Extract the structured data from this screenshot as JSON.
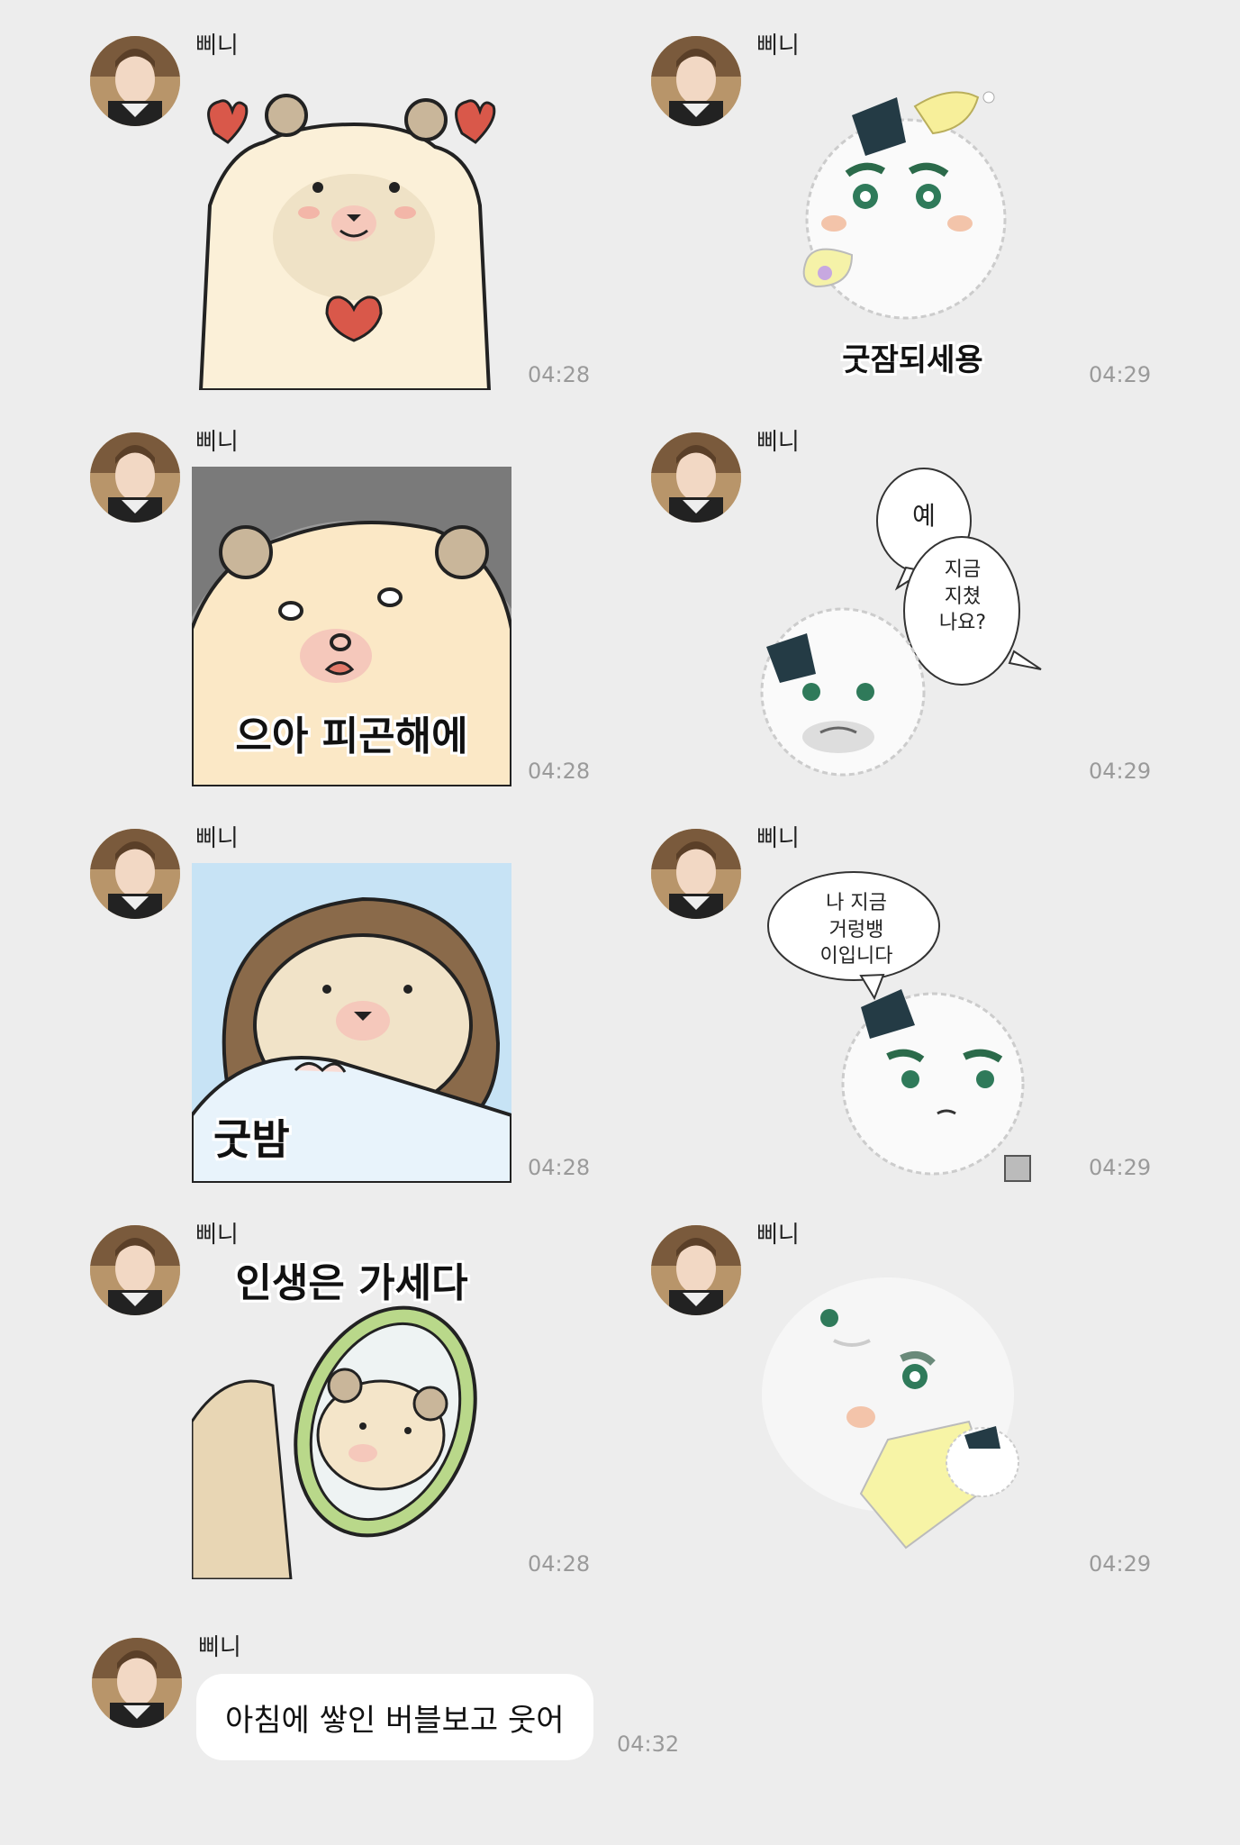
{
  "chat": {
    "sender_name": "삐니",
    "left_column": [
      {
        "time": "04:28",
        "caption": ""
      },
      {
        "time": "04:28",
        "caption": "으아 피곤해에"
      },
      {
        "time": "04:28",
        "caption": "굿밤"
      },
      {
        "time": "04:28",
        "caption": "인생은 가세다"
      }
    ],
    "right_column": [
      {
        "time": "04:29",
        "caption": "굿잠되세용"
      },
      {
        "time": "04:29",
        "bubble1": "예",
        "bubble2": "지금\n지쳤\n나요?"
      },
      {
        "time": "04:29",
        "bubble1": "나 지금\n거렁뱅\n이입니다"
      },
      {
        "time": "04:29"
      }
    ],
    "last_message": {
      "text": "아침에 쌓인 버블보고 웃어",
      "time": "04:32"
    }
  },
  "colors": {
    "background": "#ededed",
    "bubble": "#ffffff",
    "time": "#9a9a9a"
  }
}
